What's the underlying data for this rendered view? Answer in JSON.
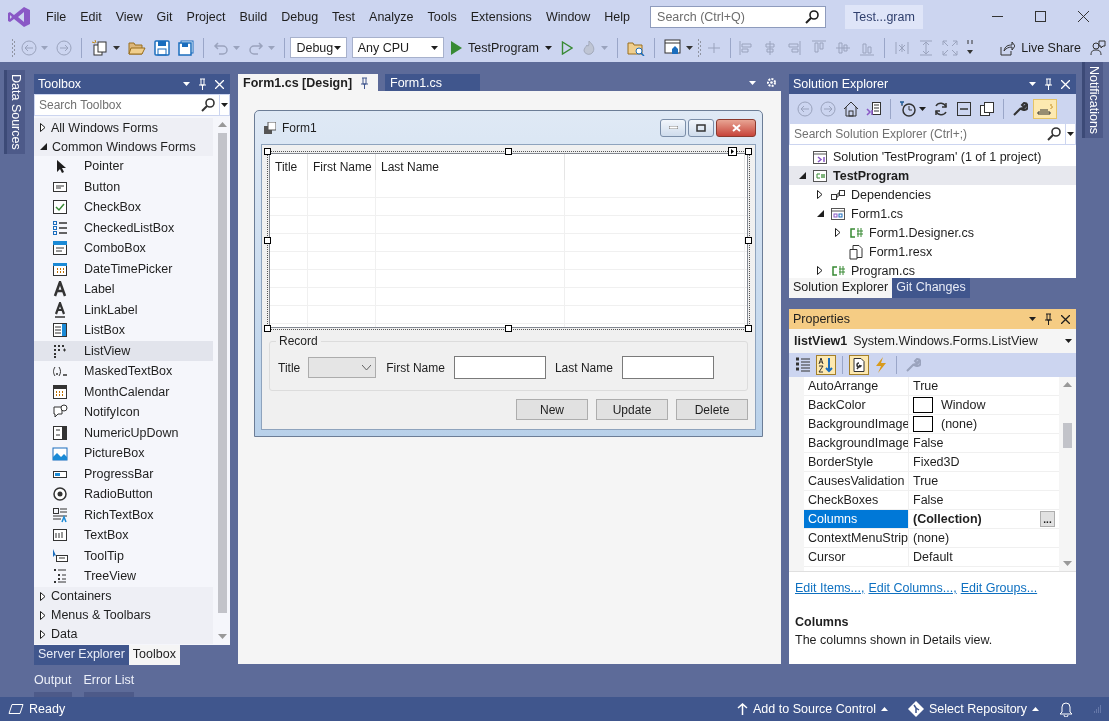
{
  "menu": [
    "File",
    "Edit",
    "View",
    "Git",
    "Project",
    "Build",
    "Debug",
    "Test",
    "Analyze",
    "Tools",
    "Extensions",
    "Window",
    "Help"
  ],
  "search": {
    "placeholder": "Search (Ctrl+Q)"
  },
  "window_title": "Test...gram",
  "toolbar": {
    "configuration": "Debug",
    "platform": "Any CPU",
    "start": "TestProgram",
    "live_share": "Live Share"
  },
  "left_side_tabs": [
    "Data Sources"
  ],
  "right_side_tabs": [
    "Notifications"
  ],
  "toolbox": {
    "title": "Toolbox",
    "search": {
      "placeholder": "Search Toolbox"
    },
    "groups": [
      {
        "label": "All Windows Forms",
        "expanded": false
      },
      {
        "label": "Common Windows Forms",
        "expanded": true,
        "children": [
          {
            "label": "Pointer",
            "selected": false
          },
          {
            "label": "Button",
            "selected": false
          },
          {
            "label": "CheckBox",
            "selected": false
          },
          {
            "label": "CheckedListBox",
            "selected": false
          },
          {
            "label": "ComboBox",
            "selected": false
          },
          {
            "label": "DateTimePicker",
            "selected": false
          },
          {
            "label": "Label",
            "selected": false
          },
          {
            "label": "LinkLabel",
            "selected": false
          },
          {
            "label": "ListBox",
            "selected": false
          },
          {
            "label": "ListView",
            "selected": true
          },
          {
            "label": "MaskedTextBox",
            "selected": false
          },
          {
            "label": "MonthCalendar",
            "selected": false
          },
          {
            "label": "NotifyIcon",
            "selected": false
          },
          {
            "label": "NumericUpDown",
            "selected": false
          },
          {
            "label": "PictureBox",
            "selected": false
          },
          {
            "label": "ProgressBar",
            "selected": false
          },
          {
            "label": "RadioButton",
            "selected": false
          },
          {
            "label": "RichTextBox",
            "selected": false
          },
          {
            "label": "TextBox",
            "selected": false
          },
          {
            "label": "ToolTip",
            "selected": false
          },
          {
            "label": "TreeView",
            "selected": false
          }
        ]
      },
      {
        "label": "Containers",
        "expanded": false
      },
      {
        "label": "Menus & Toolbars",
        "expanded": false
      },
      {
        "label": "Data",
        "expanded": false
      }
    ],
    "tabs": [
      {
        "label": "Server Explorer",
        "selected": false
      },
      {
        "label": "Toolbox",
        "selected": true
      }
    ]
  },
  "bottom_tabs": [
    "Output",
    "Error List"
  ],
  "document_tabs": [
    {
      "label": "Form1.cs [Design]",
      "selected": true
    },
    {
      "label": "Form1.cs",
      "selected": false
    }
  ],
  "form": {
    "title": "Form1",
    "columns": [
      "Title",
      "First Name",
      "Last Name"
    ],
    "group": "Record",
    "fields": [
      {
        "label": "Title",
        "kind": "combo"
      },
      {
        "label": "First Name",
        "kind": "text"
      },
      {
        "label": "Last Name",
        "kind": "text"
      }
    ],
    "buttons": [
      "New",
      "Update",
      "Delete"
    ]
  },
  "solution_explorer": {
    "title": "Solution Explorer",
    "search": {
      "placeholder": "Search Solution Explorer (Ctrl+;)"
    },
    "tree": [
      {
        "label": "Solution 'TestProgram' (1 of 1 project)",
        "kind": "solution",
        "selected": false,
        "startup": false,
        "children": [
          {
            "label": "TestProgram",
            "kind": "project",
            "expanded": true,
            "selected": true,
            "startup": true,
            "children": [
              {
                "label": "Dependencies",
                "kind": "dependencies",
                "expanded": false,
                "selected": false,
                "startup": false
              },
              {
                "label": "Form1.cs",
                "kind": "form",
                "expanded": true,
                "selected": false,
                "startup": false,
                "children": [
                  {
                    "label": "Form1.Designer.cs",
                    "kind": "csharp",
                    "expanded": false,
                    "selected": false,
                    "startup": false
                  },
                  {
                    "label": "Form1.resx",
                    "kind": "resource",
                    "selected": false,
                    "startup": false
                  }
                ]
              },
              {
                "label": "Program.cs",
                "kind": "csharp",
                "expanded": false,
                "selected": false,
                "startup": false
              }
            ]
          }
        ]
      }
    ],
    "tabs": [
      {
        "label": "Solution Explorer",
        "selected": true
      },
      {
        "label": "Git Changes",
        "selected": false
      }
    ]
  },
  "properties": {
    "title": "Properties",
    "object": "listView1",
    "type": "System.Windows.Forms.ListView",
    "rows": [
      {
        "name": "AutoArrange",
        "value": "True",
        "kind": "text",
        "selected": false,
        "non_default": false
      },
      {
        "name": "BackColor",
        "value": "Window",
        "kind": "swatch",
        "selected": false,
        "non_default": false
      },
      {
        "name": "BackgroundImage",
        "value": "(none)",
        "kind": "swatch",
        "selected": false,
        "non_default": false
      },
      {
        "name": "BackgroundImage",
        "value": "False",
        "kind": "text",
        "selected": false,
        "non_default": false
      },
      {
        "name": "BorderStyle",
        "value": "Fixed3D",
        "kind": "text",
        "selected": false,
        "non_default": false
      },
      {
        "name": "CausesValidation",
        "value": "True",
        "kind": "text",
        "selected": false,
        "non_default": false
      },
      {
        "name": "CheckBoxes",
        "value": "False",
        "kind": "text",
        "selected": false,
        "non_default": false
      },
      {
        "name": "Columns",
        "value": "(Collection)",
        "kind": "text",
        "selected": true,
        "non_default": true,
        "button": "..."
      },
      {
        "name": "ContextMenuStrip",
        "value": "(none)",
        "kind": "text",
        "selected": false,
        "non_default": false
      },
      {
        "name": "Cursor",
        "value": "Default",
        "kind": "text",
        "selected": false,
        "non_default": false
      }
    ],
    "links": [
      "Edit Items...,",
      "Edit Columns...,",
      "Edit Groups..."
    ],
    "description": {
      "title": "Columns",
      "text": "The columns shown in Details view."
    }
  },
  "status_bar": {
    "text": "Ready",
    "source_control": "Add to Source Control",
    "repository": "Select Repository"
  }
}
